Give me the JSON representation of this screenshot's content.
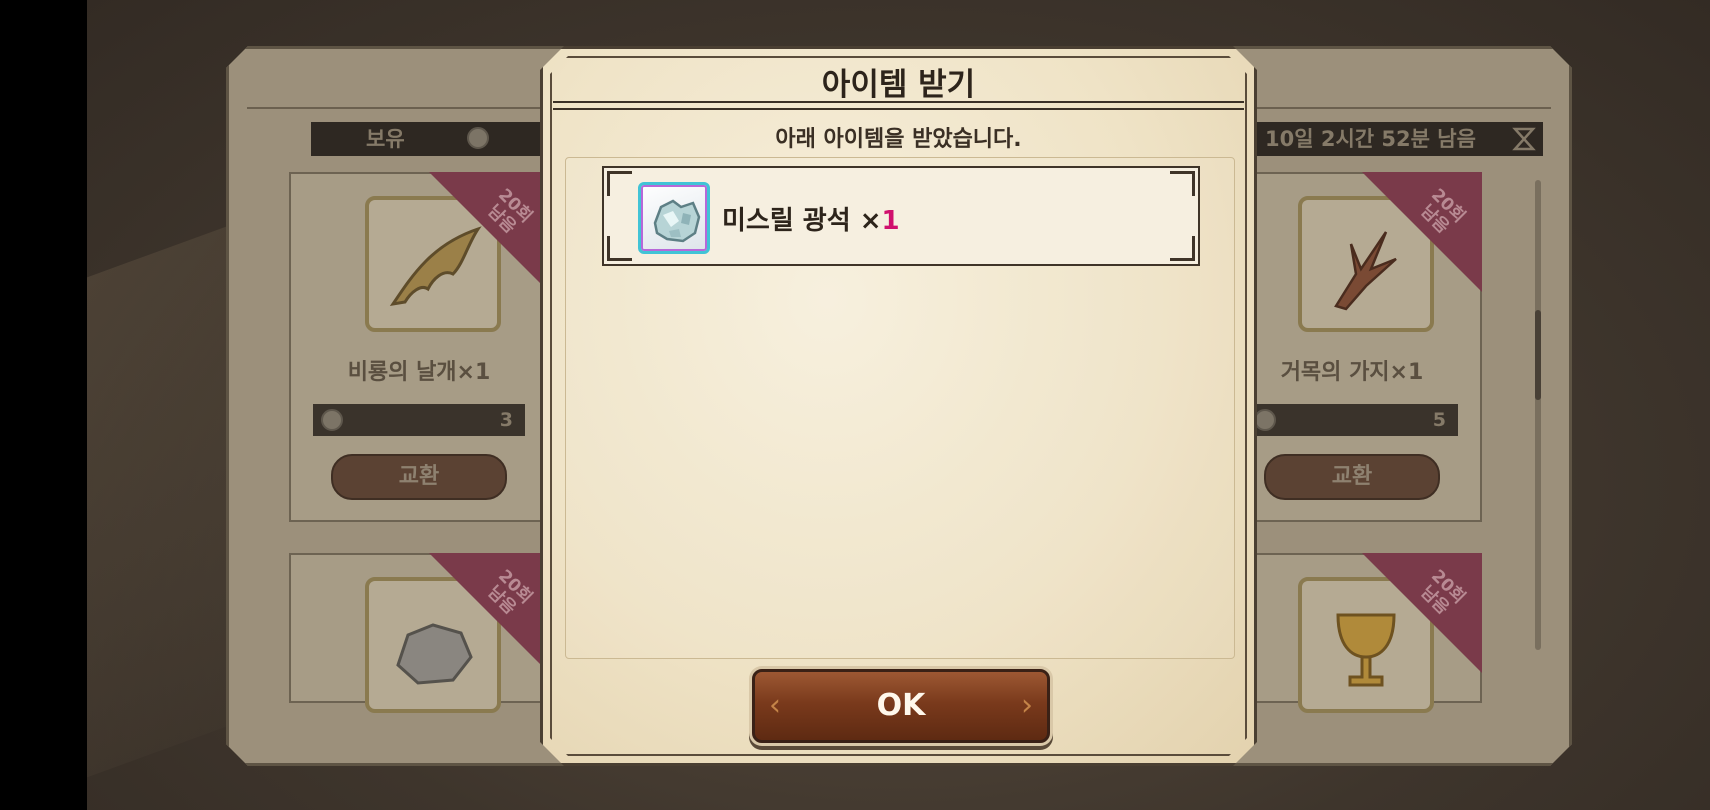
{
  "shop": {
    "balance_label": "보유",
    "time_remaining": "10일 2시간 52분 남음",
    "cards": [
      {
        "name": "비룡의 날개×1",
        "cost": "3",
        "button": "교환",
        "ribbon": "20회\n남음"
      },
      {
        "name": "거목의 가지×1",
        "cost": "5",
        "button": "교환",
        "ribbon": "20회\n남음"
      },
      {
        "ribbon": "20회\n남음"
      },
      {
        "ribbon": "20회\n남음"
      }
    ]
  },
  "dialog": {
    "title": "아이템 받기",
    "subtitle": "아래 아이템을 받았습니다.",
    "item": {
      "name": "미스릴 광석",
      "qty_prefix": "×",
      "qty": "1"
    },
    "ok_label": "OK"
  }
}
